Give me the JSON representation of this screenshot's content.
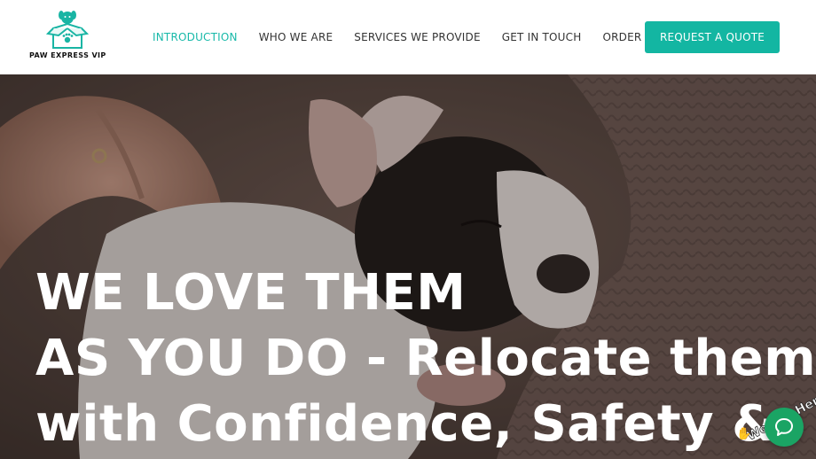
{
  "brand": {
    "name": "PAW EXPRESS VIP",
    "accent_color": "#13b6a2",
    "logo_icon": "dog-in-box-icon"
  },
  "nav": {
    "items": [
      {
        "label": "INTRODUCTION",
        "active": true
      },
      {
        "label": "WHO WE ARE",
        "active": false
      },
      {
        "label": "SERVICES WE PROVIDE",
        "active": false
      },
      {
        "label": "GET IN TOUCH",
        "active": false
      },
      {
        "label": "ORDER STATUS",
        "active": false
      }
    ],
    "cta_label": "REQUEST A QUOTE"
  },
  "hero": {
    "lines": [
      "WE LOVE THEM",
      "AS YOU DO - Relocate them",
      "with Confidence, Safety &"
    ],
    "image": "sleeping-puppy-photo"
  },
  "chat": {
    "tagline": "We Are Here!",
    "icon": "chat-bubble-icon",
    "color": "#1aa464"
  }
}
